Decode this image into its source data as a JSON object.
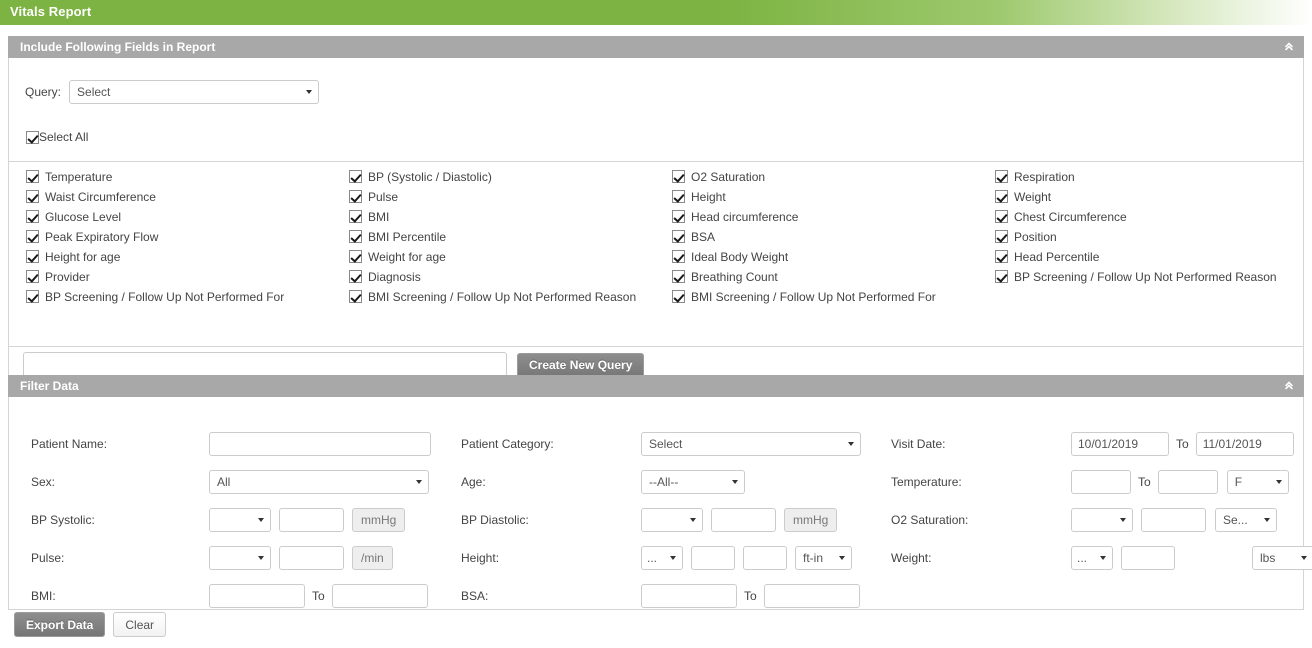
{
  "app": {
    "title": "Vitals Report",
    "accent_green": "#7cb342",
    "panel_header_gray": "#a8a8a8"
  },
  "icons": {
    "collapse": "«",
    "caret_down": "▾"
  },
  "fields_panel": {
    "header": "Include Following Fields in Report",
    "collapse_icon_name": "chevron-up-icon",
    "query": {
      "label": "Query:",
      "value": "Select"
    },
    "select_all": {
      "label": "Select All",
      "checked": true
    },
    "columns": [
      [
        "Temperature",
        "Waist Circumference",
        "Glucose Level",
        "Peak Expiratory Flow",
        "Height for age",
        "Provider",
        "BP Screening / Follow Up Not Performed For"
      ],
      [
        "BP (Systolic / Diastolic)",
        "Pulse",
        "BMI",
        "BMI Percentile",
        "Weight for age",
        "Diagnosis",
        "BMI Screening / Follow Up Not Performed Reason"
      ],
      [
        "O2 Saturation",
        "Height",
        "Head circumference",
        "BSA",
        "Ideal Body Weight",
        "Breathing Count",
        "BMI Screening / Follow Up Not Performed For"
      ],
      [
        "Respiration",
        "Weight",
        "Chest Circumference",
        "Position",
        "Head Percentile",
        "BP Screening / Follow Up Not Performed Reason"
      ]
    ],
    "new_query": {
      "input_value": "",
      "input_placeholder": "",
      "button_label": "Create New Query"
    }
  },
  "filter_panel": {
    "header": "Filter Data",
    "collapse_icon_name": "chevron-up-icon",
    "patient_name": {
      "label": "Patient Name:",
      "value": ""
    },
    "sex": {
      "label": "Sex:",
      "value": "All"
    },
    "bp_systolic": {
      "label": "BP Systolic:",
      "operator": "",
      "value": "",
      "unit": "mmHg"
    },
    "pulse": {
      "label": "Pulse:",
      "operator": "",
      "value": "",
      "unit": "/min"
    },
    "bmi": {
      "label": "BMI:",
      "from": "",
      "to_label": "To",
      "to": ""
    },
    "patient_category": {
      "label": "Patient Category:",
      "value": "Select"
    },
    "age": {
      "label": "Age:",
      "value": "--All--"
    },
    "bp_diastolic": {
      "label": "BP Diastolic:",
      "operator": "",
      "value": "",
      "unit": "mmHg"
    },
    "height": {
      "label": "Height:",
      "operator": "...",
      "value1": "",
      "value2": "",
      "unit": "ft-in"
    },
    "bsa": {
      "label": "BSA:",
      "from": "",
      "to_label": "To",
      "to": ""
    },
    "visit_date": {
      "label": "Visit Date:",
      "from": "10/01/2019",
      "to_label": "To",
      "to": "11/01/2019"
    },
    "temperature": {
      "label": "Temperature:",
      "from": "",
      "to_label": "To",
      "to": "",
      "unit": "F"
    },
    "o2_saturation": {
      "label": "O2 Saturation:",
      "operator": "",
      "value": "",
      "unit": "Se..."
    },
    "weight": {
      "label": "Weight:",
      "operator": "...",
      "value": "",
      "unit": "lbs"
    }
  },
  "actions": {
    "export_label": "Export Data",
    "clear_label": "Clear"
  }
}
